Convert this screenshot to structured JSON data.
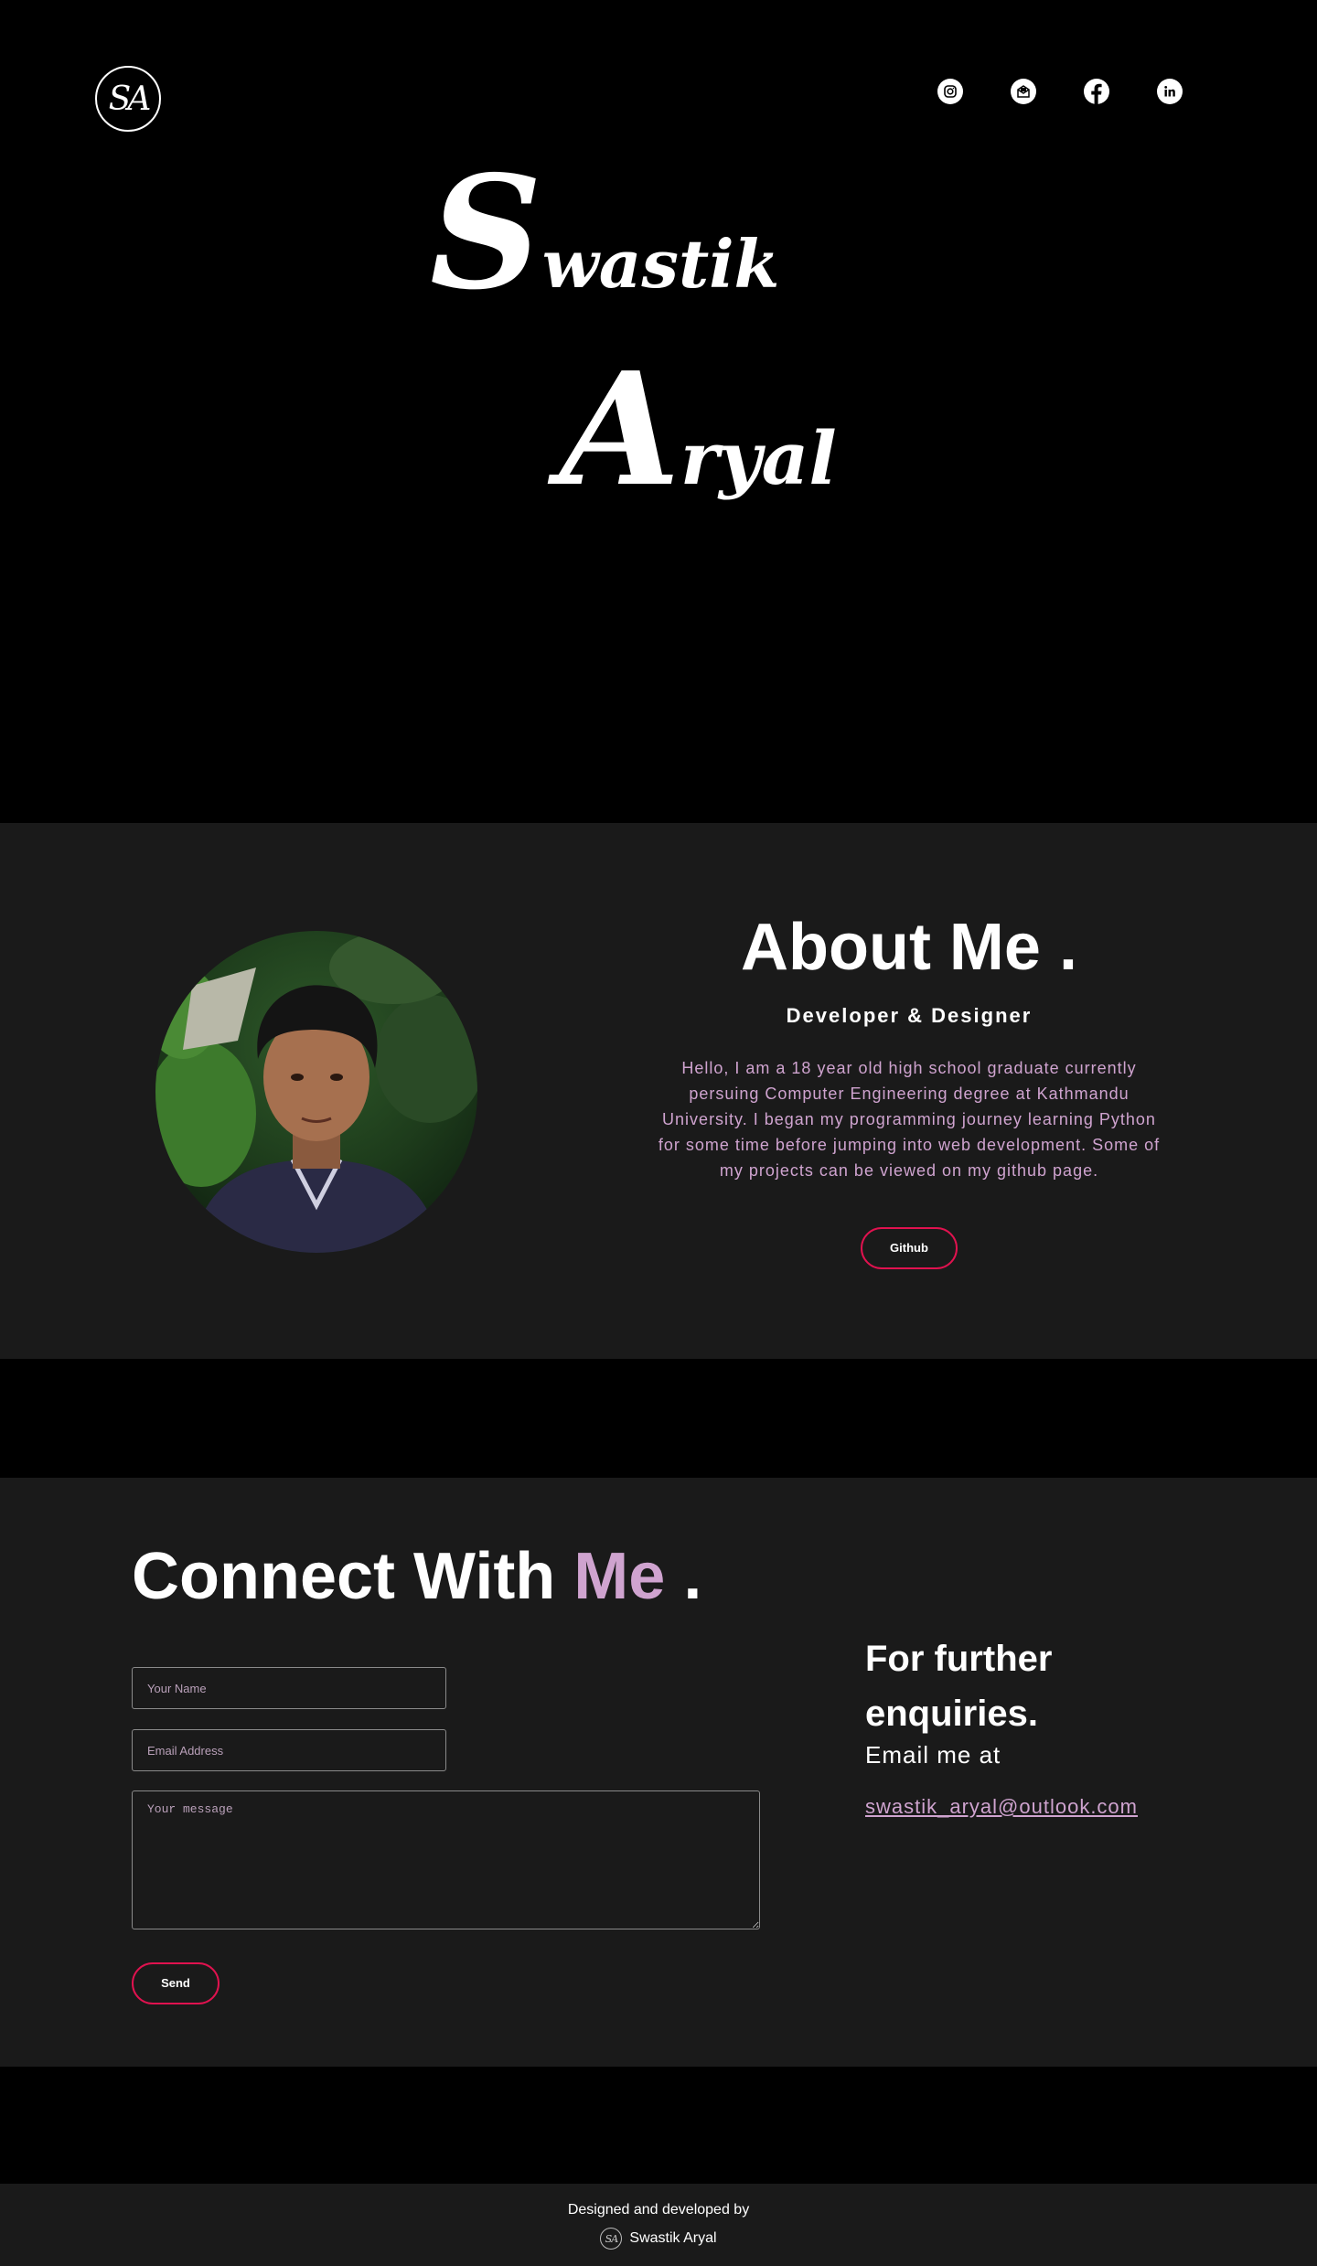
{
  "header": {
    "logo_text": "SA",
    "socials": [
      {
        "icon": "instagram-icon"
      },
      {
        "icon": "mail-icon"
      },
      {
        "icon": "facebook-icon"
      },
      {
        "icon": "linkedin-icon"
      }
    ]
  },
  "hero": {
    "first_initial": "S",
    "first_rest": "wastik",
    "last_initial": "A",
    "last_rest": "ryal"
  },
  "about": {
    "title": "About Me .",
    "subtitle": "Developer & Designer",
    "text": "Hello, I am a 18 year old high school graduate currently persuing Computer Engineering degree at Kathmandu University. I began my programming journey learning Python for some time before jumping into web development. Some of my projects can be viewed on my github page.",
    "button": "Github"
  },
  "connect": {
    "title_prefix": "Connect With ",
    "title_accent": "Me",
    "title_suffix": " .",
    "name_placeholder": "Your Name",
    "email_placeholder": "Email Address",
    "message_placeholder": "Your message",
    "send_label": "Send",
    "enquiries_title": "For further enquiries.",
    "email_prompt": "Email me at",
    "email": "swastik_aryal@outlook.com"
  },
  "footer": {
    "line1": "Designed and developed by",
    "logo_text": "SA",
    "name": "Swastik Aryal"
  },
  "colors": {
    "accent": "#cfa3cf",
    "button_border": "#e0124f",
    "section_bg": "#1a1a1a",
    "page_bg": "#000000"
  }
}
